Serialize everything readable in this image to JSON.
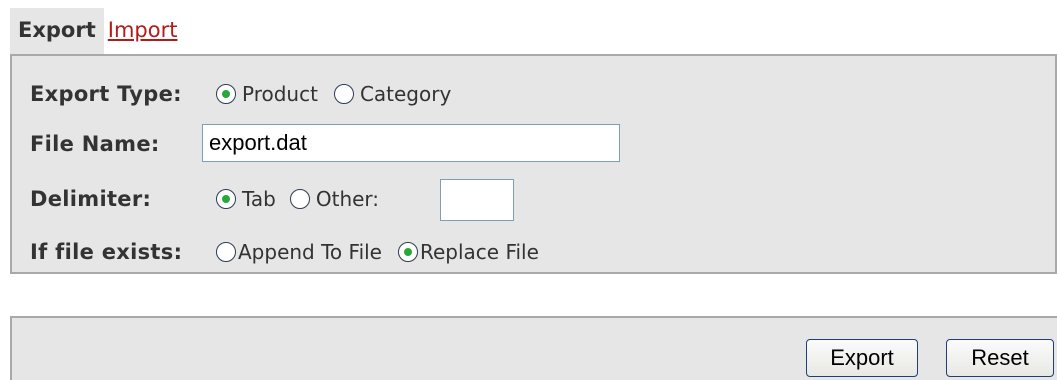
{
  "tabs": {
    "export_label": "Export",
    "import_label": "Import"
  },
  "form": {
    "export_type": {
      "label": "Export Type:",
      "options": [
        "Product",
        "Category"
      ],
      "selected": "Product"
    },
    "file_name": {
      "label": "File Name:",
      "value": "export.dat"
    },
    "delimiter": {
      "label": "Delimiter:",
      "options": [
        "Tab",
        "Other:"
      ],
      "selected": "Tab",
      "other_value": ""
    },
    "if_file_exists": {
      "label": "If file exists:",
      "options": [
        "Append To File",
        "Replace File"
      ],
      "selected": "Replace File"
    }
  },
  "buttons": {
    "export_label": "Export",
    "reset_label": "Reset"
  },
  "colors": {
    "panel_bg": "#e6e6e6",
    "border": "#a9a9a9",
    "link": "#b31b1b",
    "radio_dot": "#29a83a",
    "button_border": "#1c3f7a"
  }
}
